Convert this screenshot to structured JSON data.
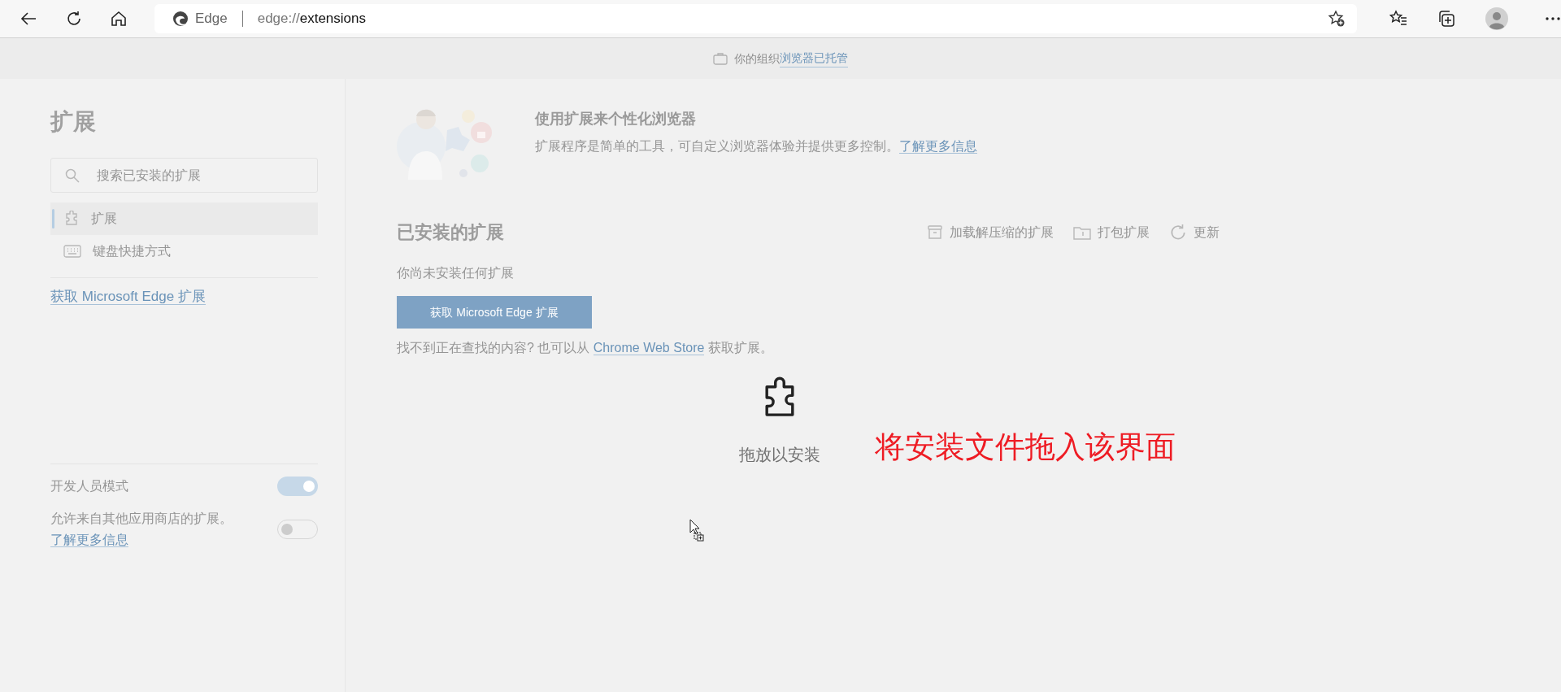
{
  "toolbar": {
    "site_label": "Edge",
    "url_scheme": "edge://",
    "url_path": "extensions"
  },
  "managed_banner": {
    "text": "你的组织",
    "link": "浏览器已托管"
  },
  "sidebar": {
    "title": "扩展",
    "search": {
      "placeholder": "搜索已安装的扩展"
    },
    "nav": [
      {
        "label": "扩展",
        "kind": "puzzle",
        "selected": true
      },
      {
        "label": "键盘快捷方式",
        "kind": "keyboard",
        "selected": false
      }
    ],
    "store_link": "获取 Microsoft Edge 扩展",
    "settings": [
      {
        "label": "开发人员模式",
        "on": true
      },
      {
        "label": "允许来自其他应用商店的扩展。",
        "link": "了解更多信息",
        "on": false
      }
    ]
  },
  "promo": {
    "title": "使用扩展来个性化浏览器",
    "description": "扩展程序是简单的工具，可自定义浏览器体验并提供更多控制。",
    "link": "了解更多信息"
  },
  "installed": {
    "heading": "已安装的扩展",
    "actions": [
      {
        "label": "加载解压缩的扩展",
        "kind": "box"
      },
      {
        "label": "打包扩展",
        "kind": "folder"
      },
      {
        "label": "更新",
        "kind": "refresh"
      }
    ],
    "empty_text": "你尚未安装任何扩展",
    "get_button": "获取 Microsoft Edge 扩展",
    "footer": {
      "before": "找不到正在查找的内容? 也可以从",
      "link": "Chrome Web Store",
      "after": "获取扩展。"
    }
  },
  "drop_overlay": {
    "label": "拖放以安装"
  },
  "annotation": {
    "text": "将安装文件拖入该界面"
  }
}
